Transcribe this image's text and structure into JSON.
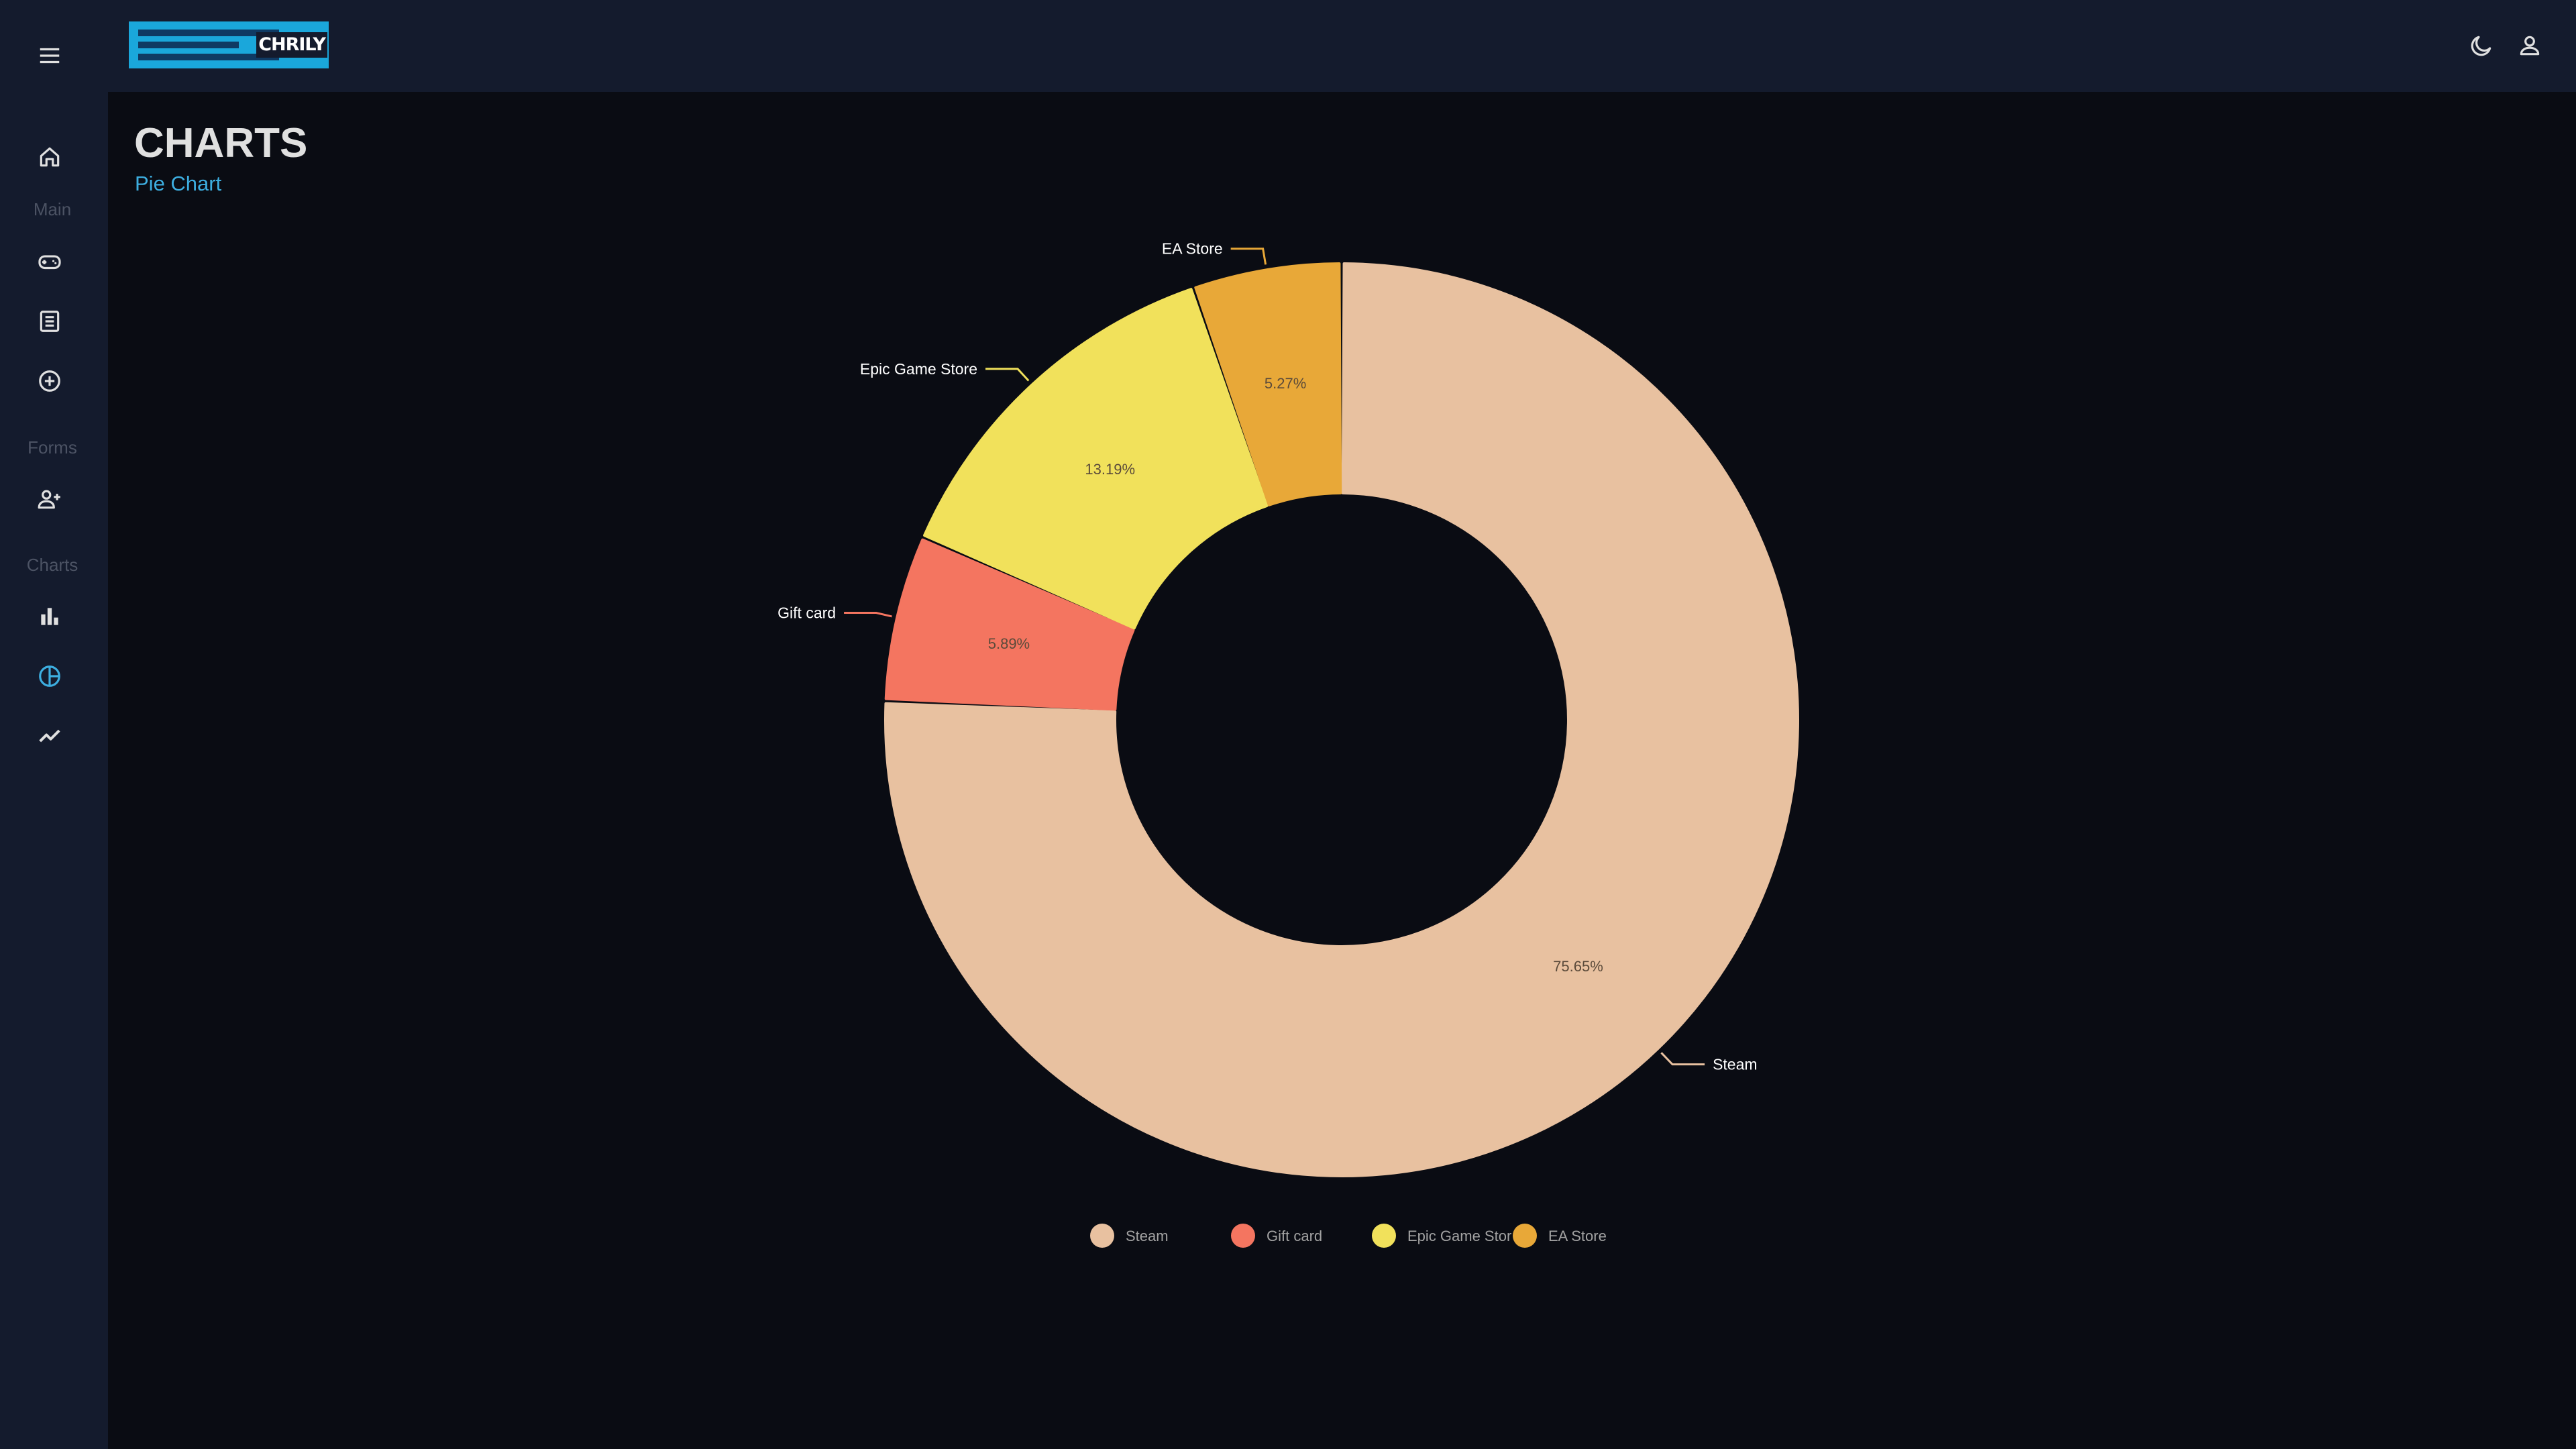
{
  "app": {
    "logo_text": "CHRILY"
  },
  "sidebar": {
    "sections": [
      {
        "label": "Main"
      },
      {
        "label": "Forms"
      },
      {
        "label": "Charts"
      }
    ]
  },
  "header": {
    "title": "CHARTS",
    "subtitle": "Pie Chart"
  },
  "colors": {
    "accent": "#3daee0",
    "background": "#0a0c13",
    "panel": "#141b2d",
    "steam": "#e8c1a0",
    "gift_card": "#f47560",
    "epic_game_store": "#f1e15b",
    "ea_store": "#e8a838"
  },
  "chart_data": {
    "type": "pie",
    "donut": true,
    "title": "",
    "categories": [
      "Steam",
      "Gift card",
      "Epic Game Store",
      "EA Store"
    ],
    "values": [
      75.65,
      5.89,
      13.19,
      5.27
    ],
    "value_labels": [
      "75.65%",
      "5.89%",
      "13.19%",
      "5.27%"
    ],
    "legend": {
      "position": "bottom",
      "items": [
        "Steam",
        "Gift card",
        "Epic Game Stor",
        "EA Store"
      ]
    }
  }
}
